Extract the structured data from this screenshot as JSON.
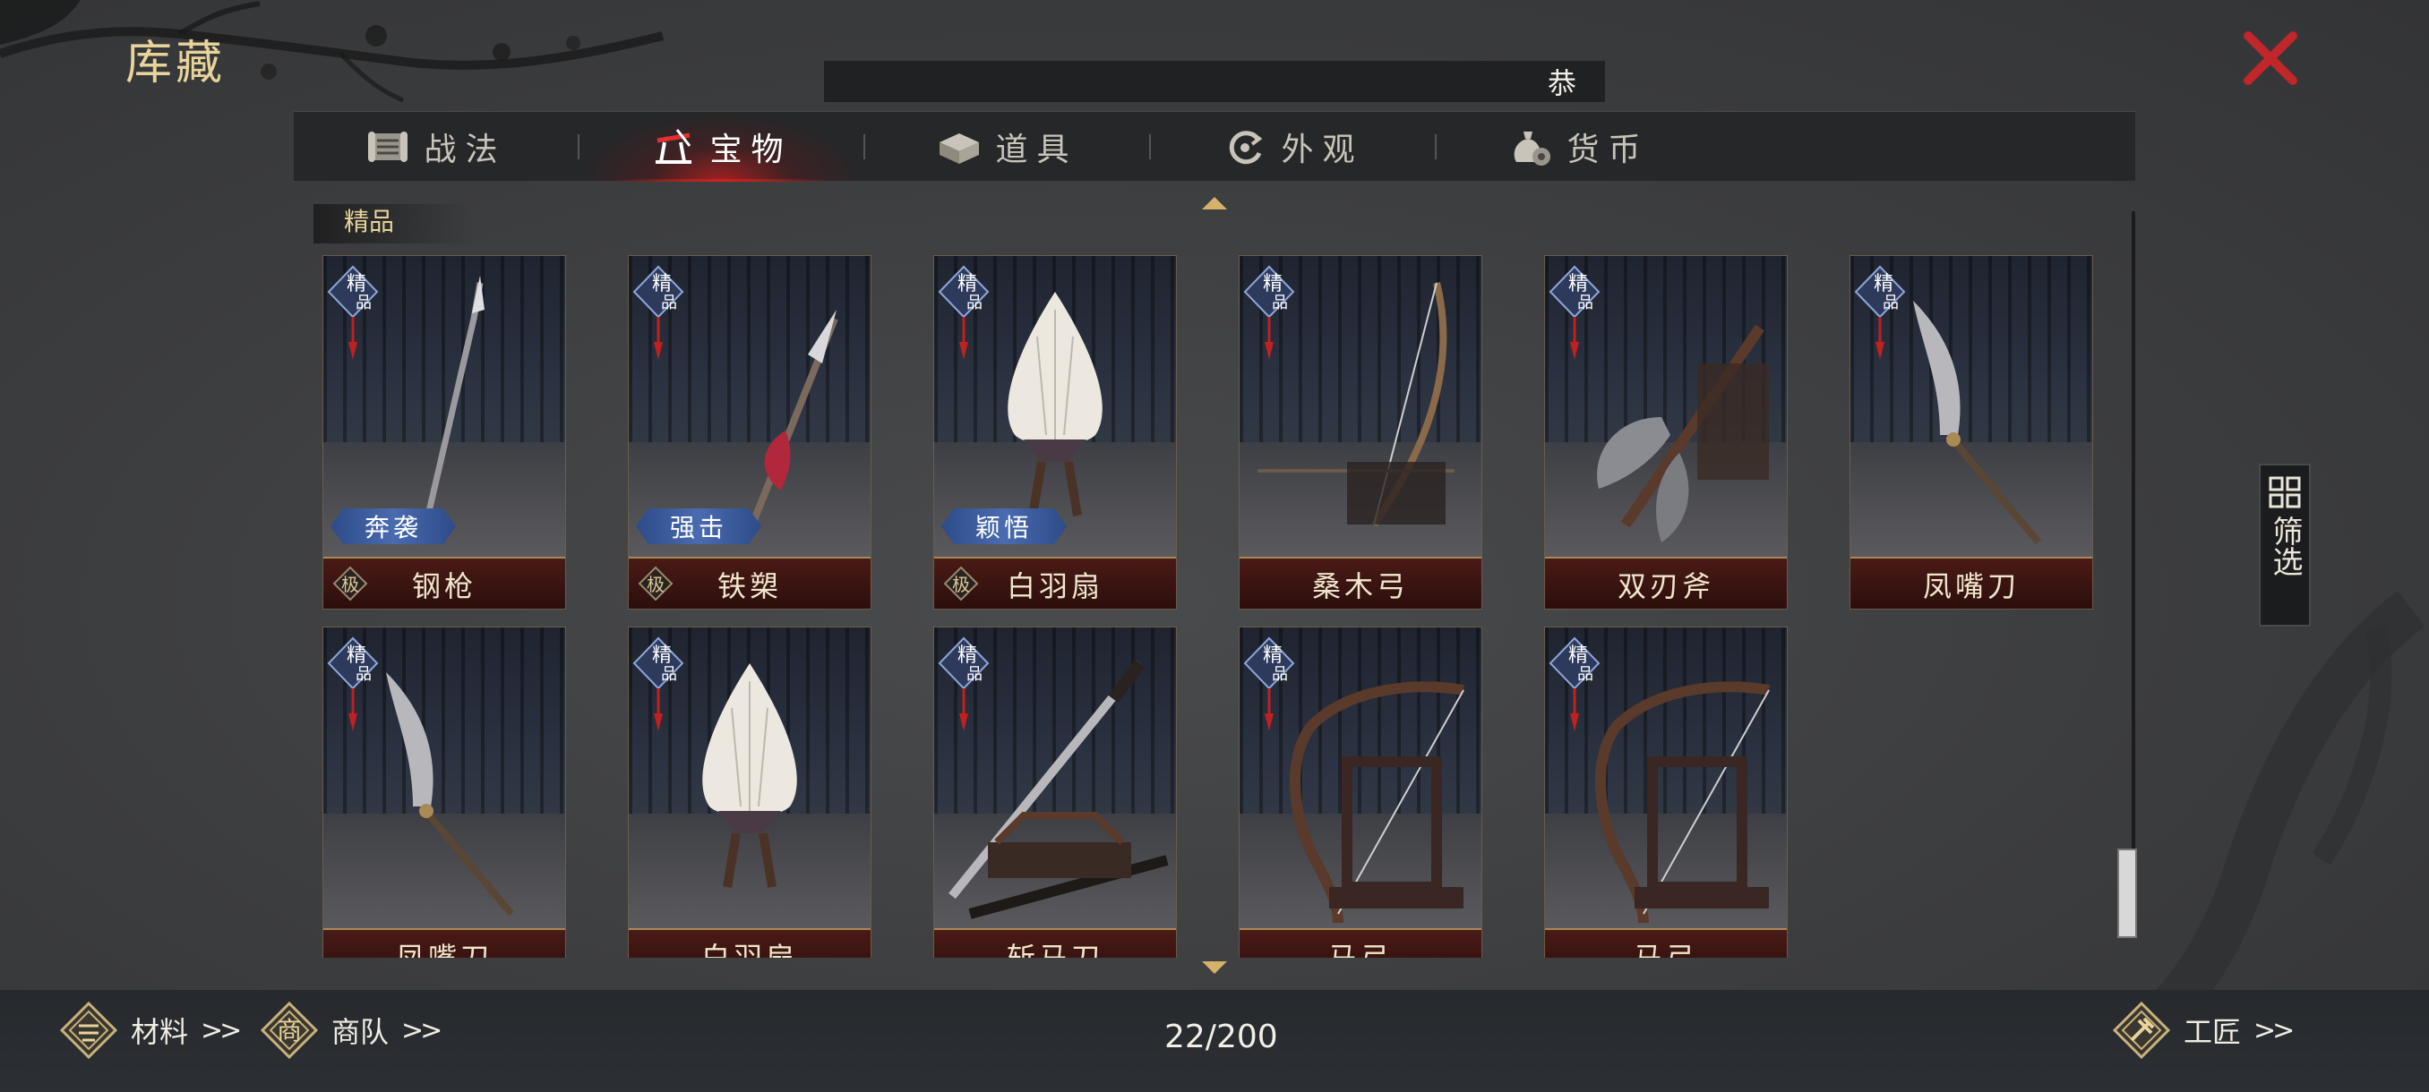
{
  "title": "库藏",
  "notice": "恭",
  "tabs": [
    {
      "label": "战法",
      "icon": "scroll-icon",
      "active": false
    },
    {
      "label": "宝物",
      "icon": "treasure-stand-icon",
      "active": true
    },
    {
      "label": "道具",
      "icon": "box-icon",
      "active": false
    },
    {
      "label": "外观",
      "icon": "swirl-icon",
      "active": false
    },
    {
      "label": "货币",
      "icon": "money-bag-icon",
      "active": false
    }
  ],
  "section_label": "精品",
  "badge_text": "精品",
  "items": [
    {
      "name": "钢枪",
      "skill": "奔袭",
      "weapon": "spear"
    },
    {
      "name": "铁槊",
      "skill": "强击",
      "weapon": "halberd"
    },
    {
      "name": "白羽扇",
      "skill": "颖悟",
      "weapon": "fan"
    },
    {
      "name": "桑木弓",
      "skill": "",
      "weapon": "longbow"
    },
    {
      "name": "双刃斧",
      "skill": "",
      "weapon": "axe"
    },
    {
      "name": "凤嘴刀",
      "skill": "",
      "weapon": "glaive"
    },
    {
      "name": "凤嘴刀",
      "skill": "",
      "weapon": "glaive"
    },
    {
      "name": "白羽扇",
      "skill": "",
      "weapon": "fan"
    },
    {
      "name": "斩马刀",
      "skill": "",
      "weapon": "sword"
    },
    {
      "name": "马弓",
      "skill": "",
      "weapon": "bow"
    },
    {
      "name": "马弓",
      "skill": "",
      "weapon": "bow"
    }
  ],
  "quality_glyph": "极",
  "filter_label": "筛选",
  "bottom": {
    "materials": "材料",
    "caravan": "商队",
    "caravan_glyph": "商",
    "count": "22/200",
    "craftsman": "工匠"
  },
  "colors": {
    "accent_red": "#c0262a",
    "gold": "#e8d39a",
    "skill_blue": "#4a6bb0"
  }
}
